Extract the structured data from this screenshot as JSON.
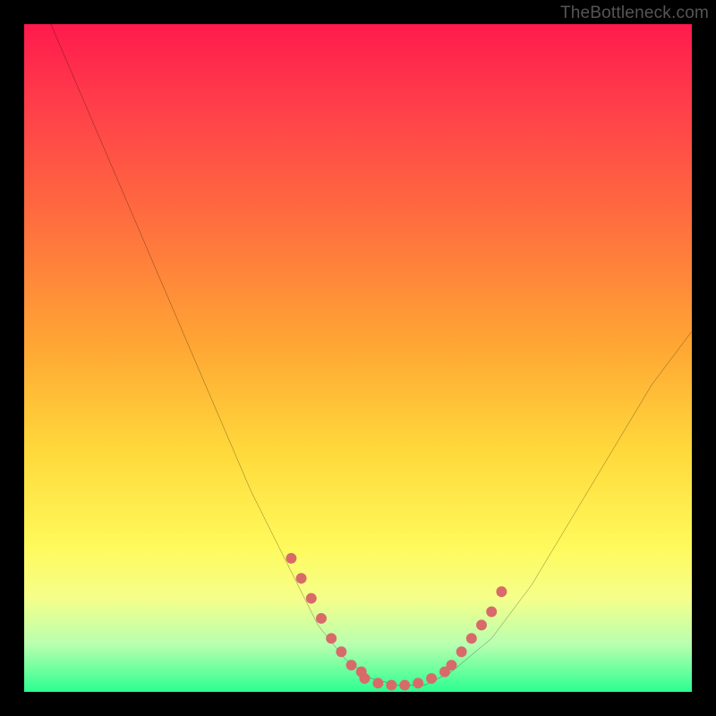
{
  "watermark": "TheBottleneck.com",
  "chart_data": {
    "type": "line",
    "title": "",
    "xlabel": "",
    "ylabel": "",
    "xlim": [
      0,
      100
    ],
    "ylim": [
      0,
      100
    ],
    "grid": false,
    "legend": false,
    "gradient_stops": [
      {
        "pct": 0,
        "color": "#ff1a4d"
      },
      {
        "pct": 12,
        "color": "#ff3e4a"
      },
      {
        "pct": 28,
        "color": "#ff6a3f"
      },
      {
        "pct": 48,
        "color": "#ffa634"
      },
      {
        "pct": 64,
        "color": "#ffd93b"
      },
      {
        "pct": 78,
        "color": "#fff95b"
      },
      {
        "pct": 86,
        "color": "#f5ff8a"
      },
      {
        "pct": 93,
        "color": "#b7ffb0"
      },
      {
        "pct": 100,
        "color": "#2bff8f"
      }
    ],
    "series": [
      {
        "name": "bottleneck-curve",
        "color": "#000000",
        "x": [
          4,
          10,
          16,
          22,
          28,
          34,
          40,
          44,
          48,
          52,
          56,
          60,
          64,
          70,
          76,
          82,
          88,
          94,
          100
        ],
        "y": [
          100,
          86,
          72,
          58,
          44,
          30,
          18,
          10,
          5,
          2,
          1,
          1,
          3,
          8,
          16,
          26,
          36,
          46,
          54
        ]
      }
    ],
    "highlight_segments": [
      {
        "name": "left-dash",
        "color": "#d86a6a",
        "x": [
          40,
          41.5,
          43,
          44.5,
          46,
          47.5,
          49,
          50.5
        ],
        "y": [
          20,
          17,
          14,
          11,
          8,
          6,
          4,
          3
        ]
      },
      {
        "name": "bottom-dash",
        "color": "#d86a6a",
        "x": [
          51,
          53,
          55,
          57,
          59,
          61,
          63
        ],
        "y": [
          2,
          1.3,
          1,
          1,
          1.3,
          2,
          3
        ]
      },
      {
        "name": "right-dash",
        "color": "#d86a6a",
        "x": [
          64,
          65.5,
          67,
          68.5,
          70,
          71.5
        ],
        "y": [
          4,
          6,
          8,
          10,
          12,
          15
        ]
      }
    ]
  }
}
